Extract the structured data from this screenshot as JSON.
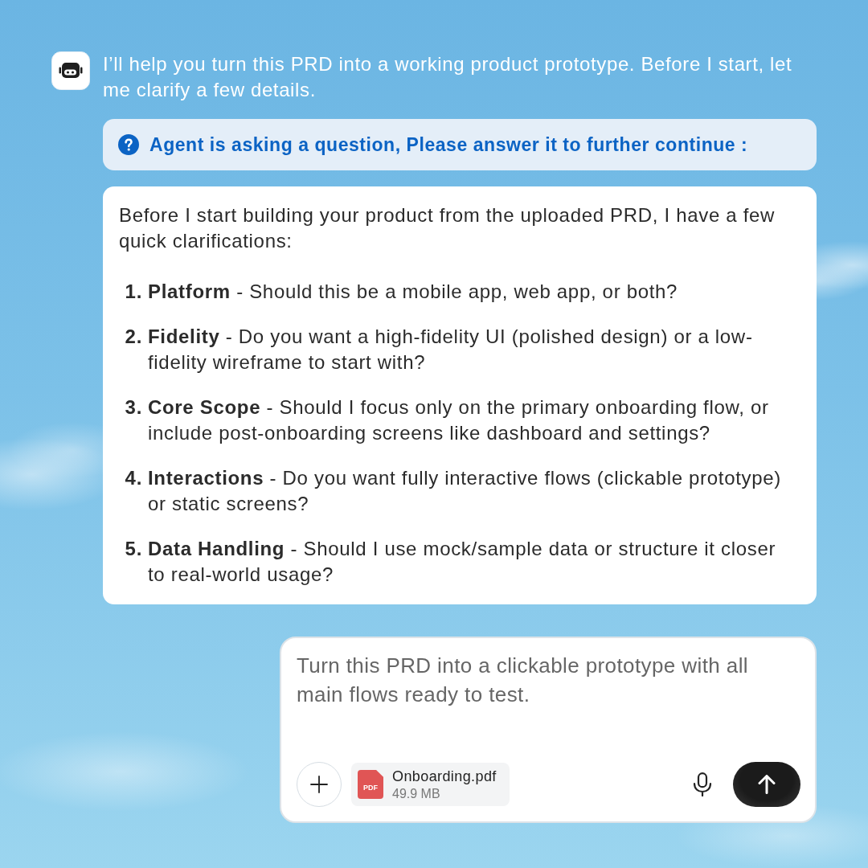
{
  "message": {
    "text": "I’ll help you turn this PRD into a working product prototype. Before I start, let me clarify a few details."
  },
  "notice": {
    "text": "Agent is asking a question, Please answer it to further continue :"
  },
  "questions": {
    "intro": "Before I start building your product from the uploaded PRD, I have a few quick clarifications:",
    "items": [
      {
        "number": "1.",
        "text": "**Platform** - Should this be a mobile app, web app, or both?"
      },
      {
        "number": "2.",
        "text": "**Fidelity** - Do you want a high-fidelity UI (polished design) or a low-fidelity wireframe to start with?"
      },
      {
        "number": "3.",
        "text": "**Core Scope** - Should I focus only on the primary onboarding flow, or include post-onboarding screens like dashboard and settings?"
      },
      {
        "number": "4.",
        "text": "**Interactions** - Do you want fully interactive flows (clickable prototype) or static screens?"
      },
      {
        "number": "5.",
        "text": "**Data Handling** - Should I use mock/sample data or structure it closer to real-world usage?"
      }
    ]
  },
  "composer": {
    "value": "Turn this PRD into a clickable prototype with all main flows ready to test.",
    "attachment": {
      "type": "PDF",
      "name": "Onboarding.pdf",
      "size": "49.9 MB"
    }
  }
}
